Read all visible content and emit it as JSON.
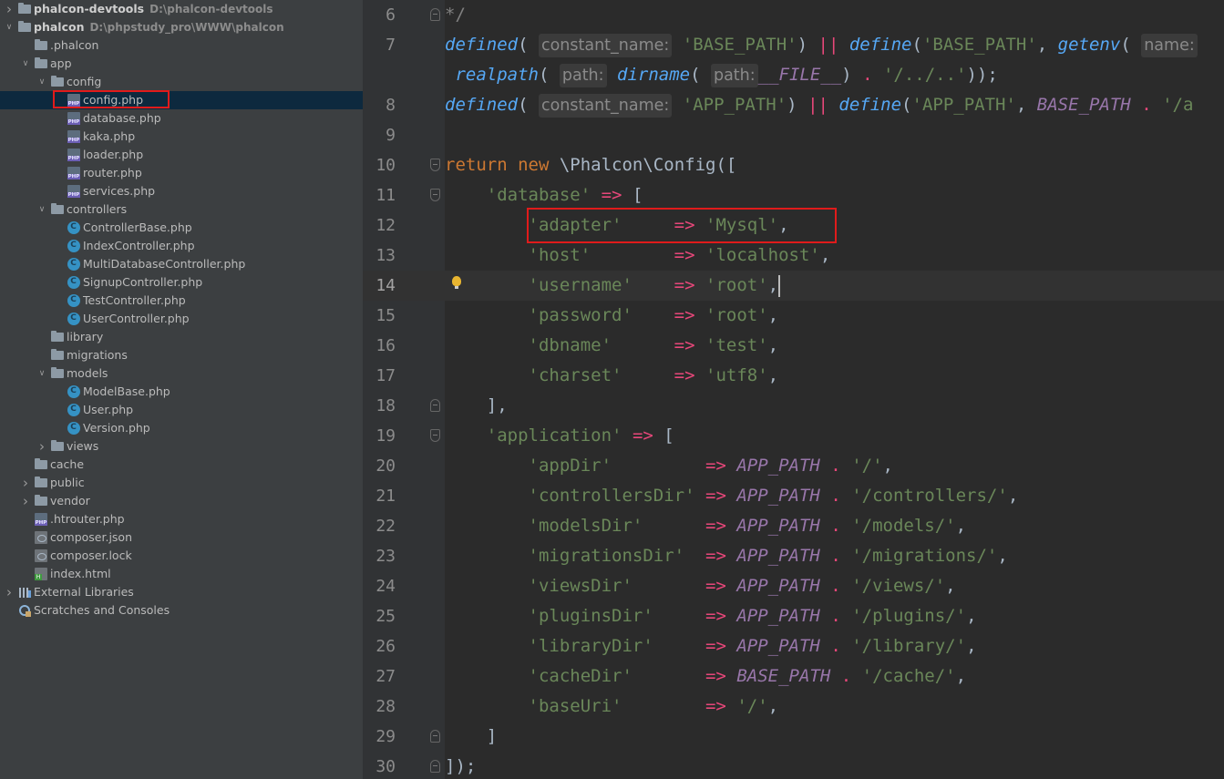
{
  "tree": {
    "rows": [
      {
        "label": "phalcon-devtools",
        "path": "D:\\phalcon-devtools",
        "type": "folder",
        "bold": true
      },
      {
        "label": "phalcon",
        "path": "D:\\phpstudy_pro\\WWW\\phalcon",
        "type": "folder",
        "bold": true
      },
      {
        "label": ".phalcon",
        "type": "folder"
      },
      {
        "label": "app",
        "type": "folder"
      },
      {
        "label": "config",
        "type": "folder"
      },
      {
        "label": "config.php",
        "type": "php",
        "selected": true
      },
      {
        "label": "database.php",
        "type": "php"
      },
      {
        "label": "kaka.php",
        "type": "php"
      },
      {
        "label": "loader.php",
        "type": "php"
      },
      {
        "label": "router.php",
        "type": "php"
      },
      {
        "label": "services.php",
        "type": "php"
      },
      {
        "label": "controllers",
        "type": "folder"
      },
      {
        "label": "ControllerBase.php",
        "type": "class"
      },
      {
        "label": "IndexController.php",
        "type": "class"
      },
      {
        "label": "MultiDatabaseController.php",
        "type": "class"
      },
      {
        "label": "SignupController.php",
        "type": "class"
      },
      {
        "label": "TestController.php",
        "type": "class"
      },
      {
        "label": "UserController.php",
        "type": "class"
      },
      {
        "label": "library",
        "type": "folder"
      },
      {
        "label": "migrations",
        "type": "folder"
      },
      {
        "label": "models",
        "type": "folder"
      },
      {
        "label": "ModelBase.php",
        "type": "class"
      },
      {
        "label": "User.php",
        "type": "class"
      },
      {
        "label": "Version.php",
        "type": "class"
      },
      {
        "label": "views",
        "type": "folder"
      },
      {
        "label": "cache",
        "type": "folder"
      },
      {
        "label": "public",
        "type": "folder"
      },
      {
        "label": "vendor",
        "type": "folder"
      },
      {
        "label": ".htrouter.php",
        "type": "php"
      },
      {
        "label": "composer.json",
        "type": "json"
      },
      {
        "label": "composer.lock",
        "type": "json"
      },
      {
        "label": "index.html",
        "type": "html"
      },
      {
        "label": "External Libraries",
        "type": "lib"
      },
      {
        "label": "Scratches and Consoles",
        "type": "scratch"
      }
    ]
  },
  "editor": {
    "lines": [
      {
        "n": "6",
        "tokens": [
          [
            "cm",
            "*/"
          ]
        ]
      },
      {
        "n": "7",
        "tokens": [
          [
            "fn",
            "defined"
          ],
          [
            "plain",
            "( "
          ],
          [
            "hint",
            "constant_name:"
          ],
          [
            "str",
            " 'BASE_PATH'"
          ],
          [
            "plain",
            ") "
          ],
          [
            "op",
            "||"
          ],
          [
            "plain",
            " "
          ],
          [
            "fn",
            "define"
          ],
          [
            "plain",
            "("
          ],
          [
            "str",
            "'BASE_PATH'"
          ],
          [
            "plain",
            ", "
          ],
          [
            "fn",
            "getenv"
          ],
          [
            "plain",
            "( "
          ],
          [
            "hint",
            "name:"
          ]
        ]
      },
      {
        "n": "",
        "tokens": [
          [
            "plain",
            " "
          ],
          [
            "fn",
            "realpath"
          ],
          [
            "plain",
            "( "
          ],
          [
            "hint",
            "path:"
          ],
          [
            "plain",
            " "
          ],
          [
            "fn",
            "dirname"
          ],
          [
            "plain",
            "( "
          ],
          [
            "hint",
            "path:"
          ],
          [
            "const",
            "__FILE__"
          ],
          [
            "plain",
            ") "
          ],
          [
            "op",
            "."
          ],
          [
            "plain",
            " "
          ],
          [
            "str",
            "'/../..'"
          ],
          [
            "plain",
            "));"
          ]
        ]
      },
      {
        "n": "8",
        "tokens": [
          [
            "fn",
            "defined"
          ],
          [
            "plain",
            "( "
          ],
          [
            "hint",
            "constant_name:"
          ],
          [
            "str",
            " 'APP_PATH'"
          ],
          [
            "plain",
            ") "
          ],
          [
            "op",
            "||"
          ],
          [
            "plain",
            " "
          ],
          [
            "fn",
            "define"
          ],
          [
            "plain",
            "("
          ],
          [
            "str",
            "'APP_PATH'"
          ],
          [
            "plain",
            ", "
          ],
          [
            "const",
            "BASE_PATH"
          ],
          [
            "plain",
            " "
          ],
          [
            "op",
            "."
          ],
          [
            "plain",
            " "
          ],
          [
            "str",
            "'/a"
          ]
        ]
      },
      {
        "n": "9",
        "tokens": []
      },
      {
        "n": "10",
        "tokens": [
          [
            "kw",
            "return"
          ],
          [
            "plain",
            " "
          ],
          [
            "kw",
            "new"
          ],
          [
            "plain",
            " \\Phalcon\\Config(["
          ]
        ]
      },
      {
        "n": "11",
        "tokens": [
          [
            "plain",
            "    "
          ],
          [
            "str",
            "'database'"
          ],
          [
            "plain",
            " "
          ],
          [
            "op",
            "=>"
          ],
          [
            "plain",
            " ["
          ]
        ]
      },
      {
        "n": "12",
        "tokens": [
          [
            "plain",
            "        "
          ],
          [
            "str",
            "'adapter'"
          ],
          [
            "plain",
            "     "
          ],
          [
            "op",
            "=>"
          ],
          [
            "plain",
            " "
          ],
          [
            "str",
            "'Mysql'"
          ],
          [
            "plain",
            ","
          ]
        ]
      },
      {
        "n": "13",
        "tokens": [
          [
            "plain",
            "        "
          ],
          [
            "str",
            "'host'"
          ],
          [
            "plain",
            "        "
          ],
          [
            "op",
            "=>"
          ],
          [
            "plain",
            " "
          ],
          [
            "str",
            "'localhost'"
          ],
          [
            "plain",
            ","
          ]
        ]
      },
      {
        "n": "14",
        "tokens": [
          [
            "plain",
            "        "
          ],
          [
            "str",
            "'username'"
          ],
          [
            "plain",
            "    "
          ],
          [
            "op",
            "=>"
          ],
          [
            "plain",
            " "
          ],
          [
            "str",
            "'root'"
          ],
          [
            "plain",
            ","
          ],
          [
            "caret",
            ""
          ]
        ],
        "current": true
      },
      {
        "n": "15",
        "tokens": [
          [
            "plain",
            "        "
          ],
          [
            "str",
            "'password'"
          ],
          [
            "plain",
            "    "
          ],
          [
            "op",
            "=>"
          ],
          [
            "plain",
            " "
          ],
          [
            "str",
            "'root'"
          ],
          [
            "plain",
            ","
          ]
        ]
      },
      {
        "n": "16",
        "tokens": [
          [
            "plain",
            "        "
          ],
          [
            "str",
            "'dbname'"
          ],
          [
            "plain",
            "      "
          ],
          [
            "op",
            "=>"
          ],
          [
            "plain",
            " "
          ],
          [
            "str",
            "'test'"
          ],
          [
            "plain",
            ","
          ]
        ]
      },
      {
        "n": "17",
        "tokens": [
          [
            "plain",
            "        "
          ],
          [
            "str",
            "'charset'"
          ],
          [
            "plain",
            "     "
          ],
          [
            "op",
            "=>"
          ],
          [
            "plain",
            " "
          ],
          [
            "str",
            "'utf8'"
          ],
          [
            "plain",
            ","
          ]
        ]
      },
      {
        "n": "18",
        "tokens": [
          [
            "plain",
            "    ],"
          ]
        ]
      },
      {
        "n": "19",
        "tokens": [
          [
            "plain",
            "    "
          ],
          [
            "str",
            "'application'"
          ],
          [
            "plain",
            " "
          ],
          [
            "op",
            "=>"
          ],
          [
            "plain",
            " ["
          ]
        ]
      },
      {
        "n": "20",
        "tokens": [
          [
            "plain",
            "        "
          ],
          [
            "str",
            "'appDir'"
          ],
          [
            "plain",
            "         "
          ],
          [
            "op",
            "=>"
          ],
          [
            "plain",
            " "
          ],
          [
            "const",
            "APP_PATH"
          ],
          [
            "plain",
            " "
          ],
          [
            "op",
            "."
          ],
          [
            "plain",
            " "
          ],
          [
            "str",
            "'/'"
          ],
          [
            "plain",
            ","
          ]
        ]
      },
      {
        "n": "21",
        "tokens": [
          [
            "plain",
            "        "
          ],
          [
            "str",
            "'controllersDir'"
          ],
          [
            "plain",
            " "
          ],
          [
            "op",
            "=>"
          ],
          [
            "plain",
            " "
          ],
          [
            "const",
            "APP_PATH"
          ],
          [
            "plain",
            " "
          ],
          [
            "op",
            "."
          ],
          [
            "plain",
            " "
          ],
          [
            "str",
            "'/controllers/'"
          ],
          [
            "plain",
            ","
          ]
        ]
      },
      {
        "n": "22",
        "tokens": [
          [
            "plain",
            "        "
          ],
          [
            "str",
            "'modelsDir'"
          ],
          [
            "plain",
            "      "
          ],
          [
            "op",
            "=>"
          ],
          [
            "plain",
            " "
          ],
          [
            "const",
            "APP_PATH"
          ],
          [
            "plain",
            " "
          ],
          [
            "op",
            "."
          ],
          [
            "plain",
            " "
          ],
          [
            "str",
            "'/models/'"
          ],
          [
            "plain",
            ","
          ]
        ]
      },
      {
        "n": "23",
        "tokens": [
          [
            "plain",
            "        "
          ],
          [
            "str",
            "'migrationsDir'"
          ],
          [
            "plain",
            "  "
          ],
          [
            "op",
            "=>"
          ],
          [
            "plain",
            " "
          ],
          [
            "const",
            "APP_PATH"
          ],
          [
            "plain",
            " "
          ],
          [
            "op",
            "."
          ],
          [
            "plain",
            " "
          ],
          [
            "str",
            "'/migrations/'"
          ],
          [
            "plain",
            ","
          ]
        ]
      },
      {
        "n": "24",
        "tokens": [
          [
            "plain",
            "        "
          ],
          [
            "str",
            "'viewsDir'"
          ],
          [
            "plain",
            "       "
          ],
          [
            "op",
            "=>"
          ],
          [
            "plain",
            " "
          ],
          [
            "const",
            "APP_PATH"
          ],
          [
            "plain",
            " "
          ],
          [
            "op",
            "."
          ],
          [
            "plain",
            " "
          ],
          [
            "str",
            "'/views/'"
          ],
          [
            "plain",
            ","
          ]
        ]
      },
      {
        "n": "25",
        "tokens": [
          [
            "plain",
            "        "
          ],
          [
            "str",
            "'pluginsDir'"
          ],
          [
            "plain",
            "     "
          ],
          [
            "op",
            "=>"
          ],
          [
            "plain",
            " "
          ],
          [
            "const",
            "APP_PATH"
          ],
          [
            "plain",
            " "
          ],
          [
            "op",
            "."
          ],
          [
            "plain",
            " "
          ],
          [
            "str",
            "'/plugins/'"
          ],
          [
            "plain",
            ","
          ]
        ]
      },
      {
        "n": "26",
        "tokens": [
          [
            "plain",
            "        "
          ],
          [
            "str",
            "'libraryDir'"
          ],
          [
            "plain",
            "     "
          ],
          [
            "op",
            "=>"
          ],
          [
            "plain",
            " "
          ],
          [
            "const",
            "APP_PATH"
          ],
          [
            "plain",
            " "
          ],
          [
            "op",
            "."
          ],
          [
            "plain",
            " "
          ],
          [
            "str",
            "'/library/'"
          ],
          [
            "plain",
            ","
          ]
        ]
      },
      {
        "n": "27",
        "tokens": [
          [
            "plain",
            "        "
          ],
          [
            "str",
            "'cacheDir'"
          ],
          [
            "plain",
            "       "
          ],
          [
            "op",
            "=>"
          ],
          [
            "plain",
            " "
          ],
          [
            "const",
            "BASE_PATH"
          ],
          [
            "plain",
            " "
          ],
          [
            "op",
            "."
          ],
          [
            "plain",
            " "
          ],
          [
            "str",
            "'/cache/'"
          ],
          [
            "plain",
            ","
          ]
        ]
      },
      {
        "n": "28",
        "tokens": [
          [
            "plain",
            "        "
          ],
          [
            "str",
            "'baseUri'"
          ],
          [
            "plain",
            "        "
          ],
          [
            "op",
            "=>"
          ],
          [
            "plain",
            " "
          ],
          [
            "str",
            "'/'"
          ],
          [
            "plain",
            ","
          ]
        ]
      },
      {
        "n": "29",
        "tokens": [
          [
            "plain",
            "    ]"
          ]
        ]
      },
      {
        "n": "30",
        "tokens": [
          [
            "plain",
            "]);"
          ]
        ]
      }
    ]
  },
  "colors": {
    "highlight_box": "#e01b1b",
    "string": "#6a8759",
    "keyword": "#cc7832",
    "operator": "#e8477a",
    "constant": "#9876aa"
  }
}
